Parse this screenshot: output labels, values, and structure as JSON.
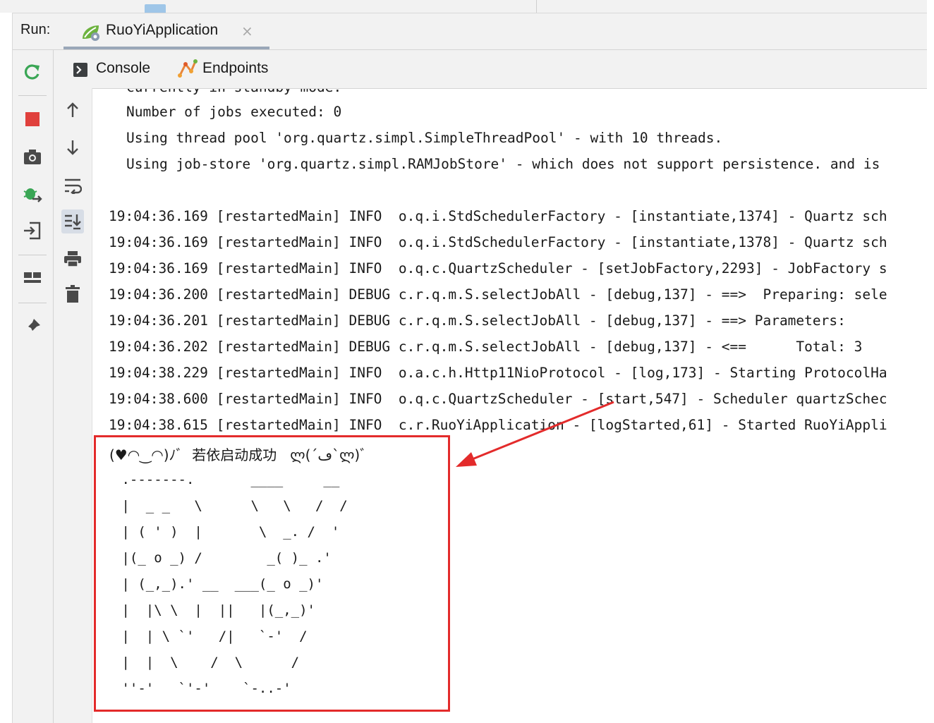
{
  "run_panel": {
    "label": "Run:",
    "tab_title": "RuoYiApplication",
    "close_glyph": "×"
  },
  "console_tabs": {
    "console_label": "Console",
    "endpoints_label": "Endpoints"
  },
  "console": {
    "cut_line": "currently in standby mode.",
    "quartz_lines": [
      "Number of jobs executed: 0",
      "Using thread pool 'org.quartz.simpl.SimpleThreadPool' - with 10 threads.",
      "Using job-store 'org.quartz.simpl.RAMJobStore' - which does not support persistence. and is"
    ],
    "log_lines": [
      "19:04:36.169 [restartedMain] INFO  o.q.i.StdSchedulerFactory - [instantiate,1374] - Quartz sch",
      "19:04:36.169 [restartedMain] INFO  o.q.i.StdSchedulerFactory - [instantiate,1378] - Quartz sch",
      "19:04:36.169 [restartedMain] INFO  o.q.c.QuartzScheduler - [setJobFactory,2293] - JobFactory s",
      "19:04:36.200 [restartedMain] DEBUG c.r.q.m.S.selectJobAll - [debug,137] - ==>  Preparing: sele",
      "19:04:36.201 [restartedMain] DEBUG c.r.q.m.S.selectJobAll - [debug,137] - ==> Parameters:",
      "19:04:36.202 [restartedMain] DEBUG c.r.q.m.S.selectJobAll - [debug,137] - <==      Total: 3",
      "19:04:38.229 [restartedMain] INFO  o.a.c.h.Http11NioProtocol - [log,173] - Starting ProtocolHa",
      "19:04:38.600 [restartedMain] INFO  o.q.c.QuartzScheduler - [start,547] - Scheduler quartzSchec",
      "19:04:38.615 [restartedMain] INFO  c.r.RuoYiApplication - [logStarted,61] - Started RuoYiAppli"
    ],
    "success_message": "(♥◠‿◠)ﾉﾞ  若依启动成功   ლ(´ڡ`ლ)ﾞ",
    "ascii_art": [
      " .-------.       ____     __",
      " |  _ _   \\      \\   \\   /  /",
      " | ( ' )  |       \\  _. /  '",
      " |(_ o _) /        _( )_ .'",
      " | (_,_).' __  ___(_ o _)'",
      " |  |\\ \\  |  ||   |(_,_)'",
      " |  | \\ `'   /|   `-'  /",
      " |  |  \\    /  \\      /",
      " ''-'   `'-'    `-..-'"
    ]
  },
  "colors": {
    "highlight": "#e32b2b",
    "stop_button": "#e0403c",
    "rerun_button": "#3aa655",
    "toolbar_bg": "#f2f2f2"
  },
  "icons": {
    "left_toolbar": [
      "rerun-icon",
      "stop-icon",
      "camera-icon",
      "debug-bug-icon",
      "import-icon",
      "layout-icon",
      "pin-icon"
    ],
    "mid_toolbar": [
      "up-arrow-icon",
      "down-arrow-icon",
      "soft-wrap-icon",
      "scroll-to-end-icon",
      "print-icon",
      "trash-icon"
    ]
  }
}
